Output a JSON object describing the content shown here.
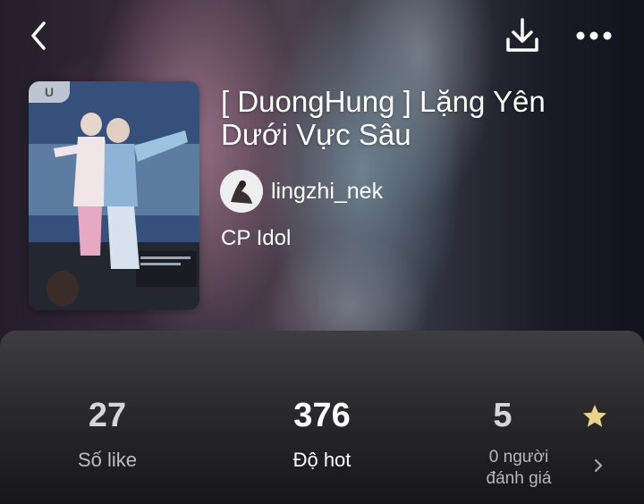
{
  "story": {
    "title": "[ DuongHung ] Lặng Yên Dưới Vực Sâu",
    "author": "lingzhi_nek",
    "category": "CP Idol",
    "cover_badge": "U"
  },
  "header": {
    "back_icon": "chevron-left-icon",
    "download_icon": "download-icon",
    "more_icon": "more-horizontal-icon"
  },
  "stats": {
    "likes": {
      "value": "27",
      "label": "Số like"
    },
    "hot": {
      "value": "376",
      "label": "Độ hot"
    },
    "rating": {
      "value": "5",
      "label_line1": "0 người",
      "label_line2": "đánh giá",
      "star_color": "#e8d48a"
    }
  },
  "colors": {
    "panel_bg": "#2a2a2d",
    "text_primary": "#ffffff",
    "text_secondary": "#bfbfc2"
  }
}
